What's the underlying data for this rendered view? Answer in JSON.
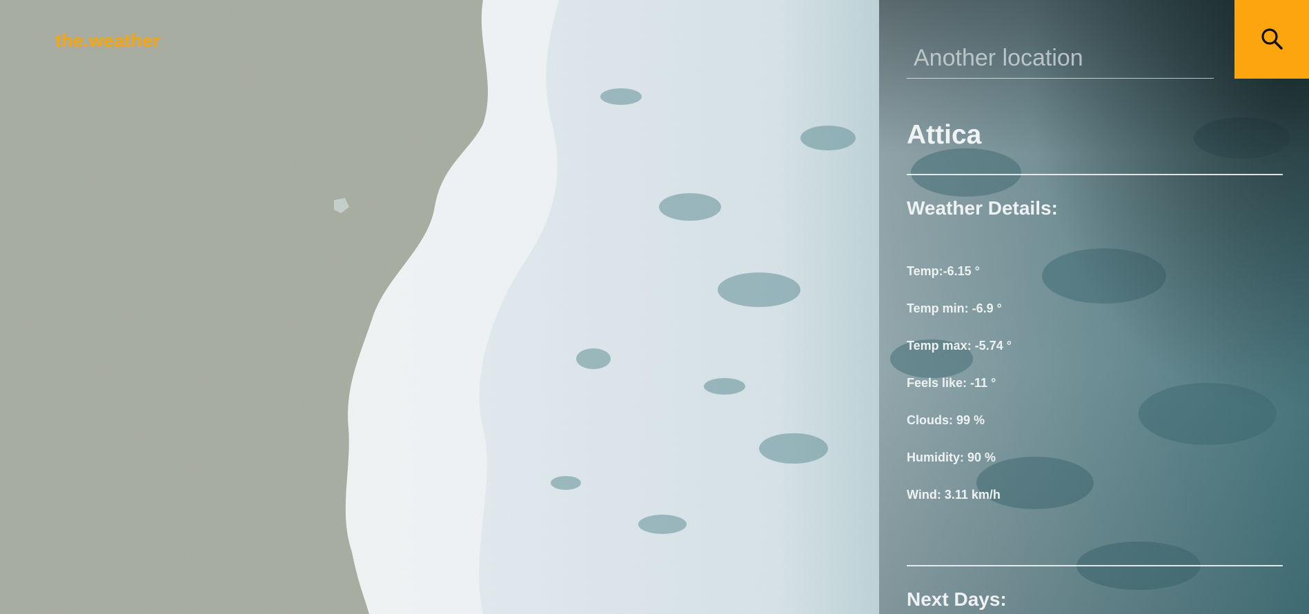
{
  "brand": {
    "title": "the.weather"
  },
  "search": {
    "placeholder": "Another location"
  },
  "location": {
    "city": "Attica"
  },
  "details": {
    "heading": "Weather Details:",
    "temp": "Temp:-6.15 °",
    "temp_min": "Temp min: -6.9 °",
    "temp_max": "Temp max: -5.74 °",
    "feels_like": "Feels like: -11 °",
    "clouds": "Clouds: 99 %",
    "humidity": "Humidity: 90 %",
    "wind": "Wind: 3.11 km/h"
  },
  "forecast": {
    "heading": "Next Days:"
  },
  "colors": {
    "accent": "#fda50f",
    "brand_text": "#f5a50e",
    "panel_text": "#eef2f2"
  },
  "icons": {
    "search": "search-icon"
  }
}
